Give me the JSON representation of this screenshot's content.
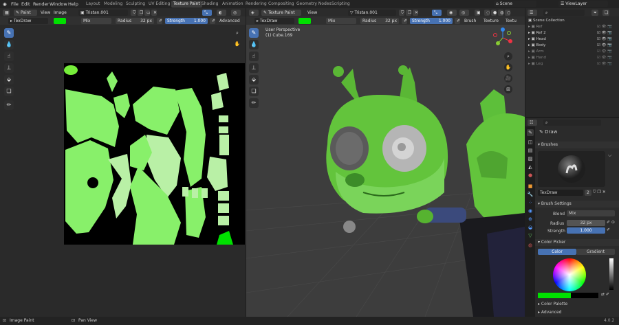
{
  "menu": [
    "File",
    "Edit",
    "Render",
    "Window",
    "Help"
  ],
  "workspaces": [
    {
      "label": "Layout",
      "active": false
    },
    {
      "label": "Modeling",
      "active": false
    },
    {
      "label": "Sculpting",
      "active": false
    },
    {
      "label": "UV Editing",
      "active": false
    },
    {
      "label": "Texture Paint",
      "active": true
    },
    {
      "label": "Shading",
      "active": false
    },
    {
      "label": "Animation",
      "active": false
    },
    {
      "label": "Rendering",
      "active": false
    },
    {
      "label": "Compositing",
      "active": false
    },
    {
      "label": "Geometry Nodes",
      "active": false
    },
    {
      "label": "Scripting",
      "active": false
    }
  ],
  "scene": {
    "name": "Scene",
    "view_layer": "ViewLayer"
  },
  "image_editor": {
    "mode": "Paint",
    "view_menu": "View",
    "image_menu": "Image",
    "image_name": "Tristan.001",
    "brush": "TexDraw",
    "blend": "Mix",
    "radius_label": "Radius",
    "radius_value": "32 px",
    "strength_label": "Strength",
    "strength_value": "1.000",
    "advanced": "Advanced",
    "color": "#00e000"
  },
  "viewport": {
    "mode": "Texture Paint",
    "view_menu": "View",
    "object_name": "Tristan.001",
    "brush": "TexDraw",
    "blend": "Mix",
    "radius_label": "Radius",
    "radius_value": "32 px",
    "strength_label": "Strength",
    "strength_value": "1.000",
    "brush_menu": "Brush",
    "texture_menu": "Texture",
    "textu_menu": "Textu",
    "overlay_title": "User Perspective",
    "overlay_sub": "(1) Cube.169"
  },
  "outliner": {
    "root": "Scene Collection",
    "items": [
      {
        "name": "Ref",
        "dim": true
      },
      {
        "name": "Ref 2",
        "dim": false
      },
      {
        "name": "Head",
        "dim": false
      },
      {
        "name": "Body",
        "dim": false
      },
      {
        "name": "Arm",
        "dim": true
      },
      {
        "name": "Hand",
        "dim": true
      },
      {
        "name": "Leg",
        "dim": true
      }
    ]
  },
  "properties": {
    "tool_name": "Draw",
    "brushes_header": "Brushes",
    "brush_name": "TexDraw",
    "brush_users": "2",
    "brush_settings_header": "Brush Settings",
    "blend_label": "Blend",
    "blend_value": "Mix",
    "radius_label": "Radius",
    "radius_value": "32 px",
    "strength_label": "Strength",
    "strength_value": "1.000",
    "color_picker_header": "Color Picker",
    "color_tab": "Color",
    "gradient_tab": "Gradient",
    "color_palette_header": "Color Palette",
    "advanced_header": "Advanced",
    "current_color": "#00e000"
  },
  "status": {
    "left": "Image Paint",
    "middle": "Pan View",
    "version": "4.0.2"
  },
  "colors": {
    "accent": "#4772b3",
    "paint_green": "#00e000",
    "light_green": "#88f06a",
    "pale_green": "#b9f0a6"
  }
}
